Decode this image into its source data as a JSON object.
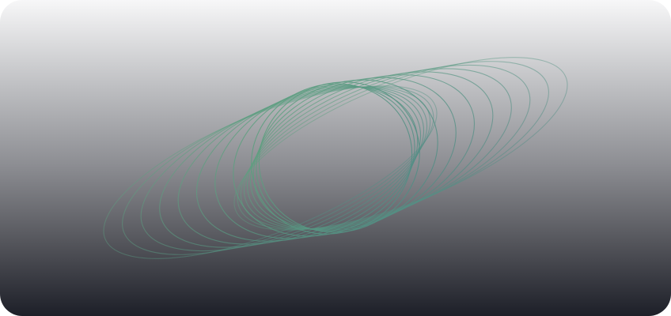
{
  "artwork": {
    "ring_count": 18,
    "colors": {
      "background_top": "#f7f7f8",
      "background_bottom": "#1d1f28",
      "ring_green": "#5fa37e",
      "ring_teal": "#4f8a86"
    }
  }
}
